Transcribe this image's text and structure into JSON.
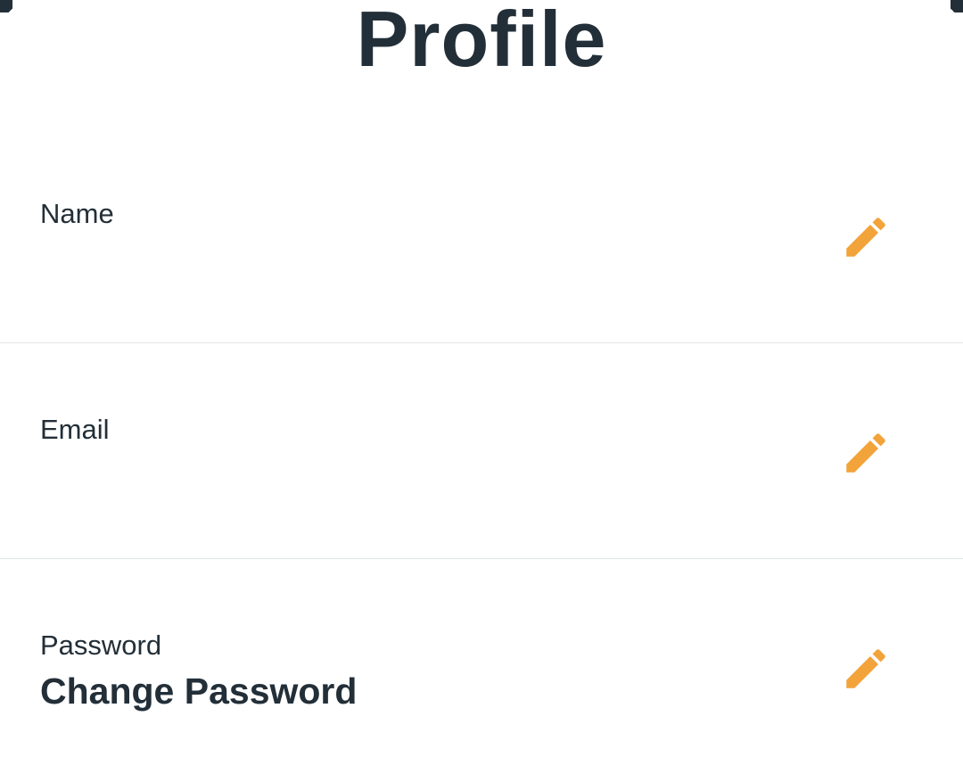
{
  "header": {
    "title": "Profile"
  },
  "fields": [
    {
      "label": "Name",
      "value": "",
      "edit_icon": "pencil-icon"
    },
    {
      "label": "Email",
      "value": "",
      "edit_icon": "pencil-icon"
    },
    {
      "label": "Password",
      "value": "Change Password",
      "edit_icon": "pencil-icon"
    }
  ],
  "colors": {
    "text": "#232f38",
    "accent": "#f2a33a",
    "divider": "#e3e6e8",
    "background": "#ffffff"
  }
}
